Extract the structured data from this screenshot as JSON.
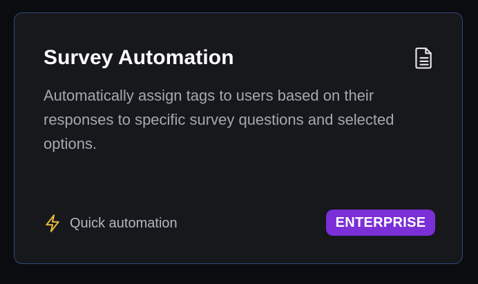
{
  "card": {
    "title": "Survey Automation",
    "description": "Automatically assign tags to users based on their responses to specific survey questions and selected options.",
    "header_icon": "document-icon",
    "footer": {
      "feature_icon": "lightning-bolt-icon",
      "feature_label": "Quick automation",
      "badge_label": "ENTERPRISE"
    }
  },
  "colors": {
    "background": "#0b0c10",
    "card_background": "#17181c",
    "card_border": "#2f4a78",
    "title": "#ffffff",
    "description": "#a6a8b0",
    "bolt_accent": "#e8b83a",
    "badge_background": "#7b2fd6"
  }
}
